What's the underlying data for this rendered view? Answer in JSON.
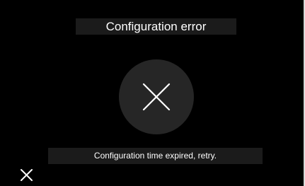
{
  "dialog": {
    "title": "Configuration error",
    "status_icon": "error-x-icon",
    "message": "Configuration time expired, retry."
  },
  "footer": {
    "close_icon": "close-icon"
  },
  "colors": {
    "background": "#000000",
    "bar": "#1b1b1b",
    "circle": "#262626",
    "icon": "#ffffff",
    "text": "#ffffff"
  }
}
